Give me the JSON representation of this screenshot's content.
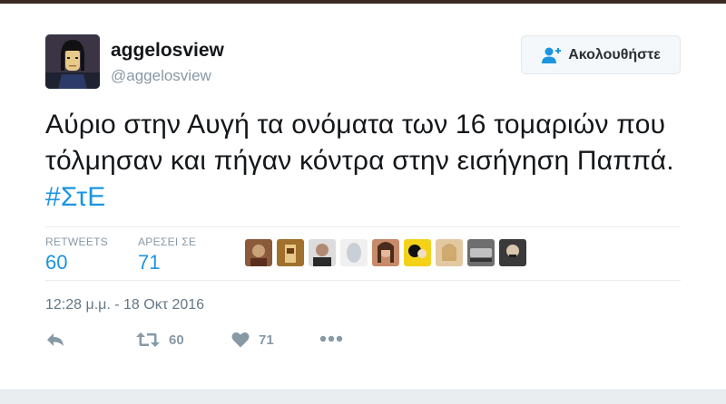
{
  "user": {
    "display_name": "aggelosview",
    "handle": "@aggelosview"
  },
  "follow_button": {
    "label": "Ακολουθήστε",
    "icon": "add-user-icon"
  },
  "tweet": {
    "text": "Αύριο στην Αυγή τα ονόματα των 16 τομαριών που τόλμησαν και πήγαν κόντρα στην εισήγηση Παππά.",
    "hashtag": "#ΣτΕ"
  },
  "stats": {
    "retweets_label": "RETWEETS",
    "retweets_value": "60",
    "likes_label": "ΑΡΕΣΕΙ ΣΕ",
    "likes_value": "71"
  },
  "timestamp": "12:28 μ.μ. - 18 Οκτ 2016",
  "actions": {
    "reply_icon": "reply-icon",
    "retweet_icon": "retweet-icon",
    "retweet_count": "60",
    "like_icon": "heart-icon",
    "like_count": "71",
    "more_icon": "more-dots-icon"
  },
  "colors": {
    "accent": "#1b95e0",
    "muted": "#8899a6",
    "text": "#14171a",
    "border": "#e6ecf0"
  }
}
